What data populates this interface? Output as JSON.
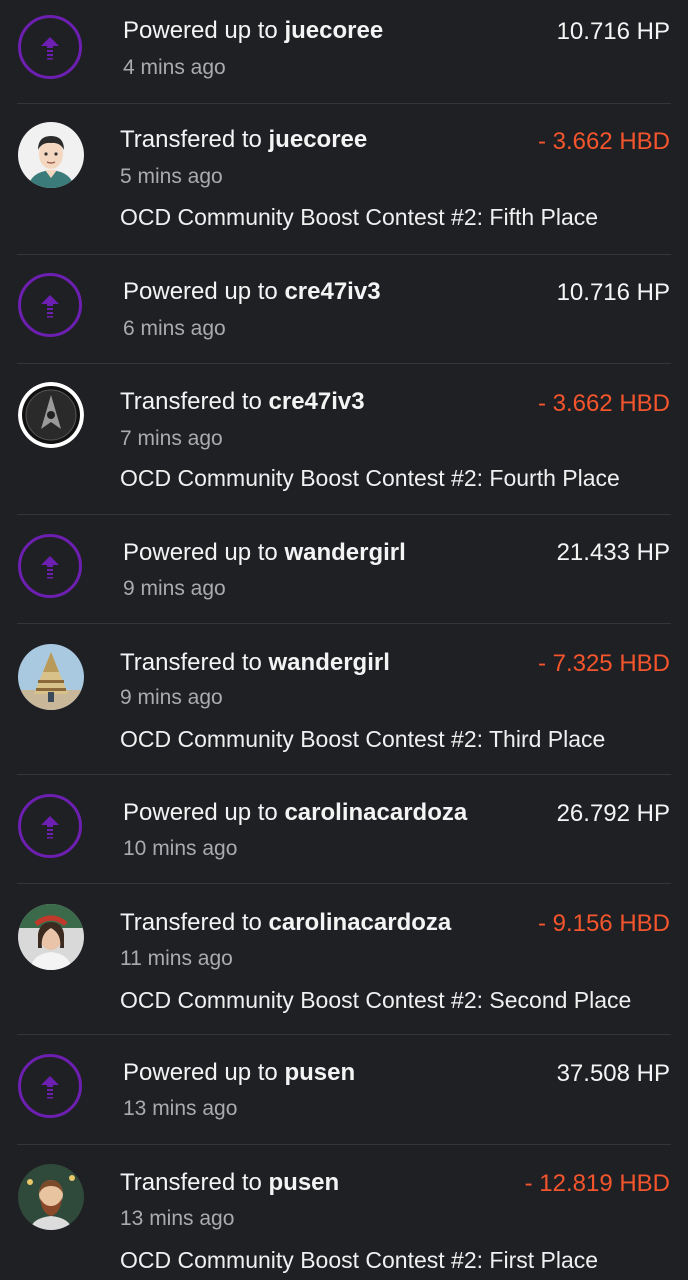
{
  "colors": {
    "background": "#1f2024",
    "accent_purple": "#6c1fb0",
    "negative_amount": "#f4552c"
  },
  "transactions": [
    {
      "type": "power_up",
      "prefix": "Powered up to",
      "user": "juecoree",
      "time": "4 mins ago",
      "amount": "10.716 HP",
      "icon": "power-up-arrow-icon"
    },
    {
      "type": "transfer",
      "prefix": "Transfered to",
      "user": "juecoree",
      "time": "5 mins ago",
      "amount": "- 3.662 HBD",
      "memo": "OCD Community Boost Contest #2: Fifth Place",
      "icon": "avatar-juecoree"
    },
    {
      "type": "power_up",
      "prefix": "Powered up to",
      "user": "cre47iv3",
      "time": "6 mins ago",
      "amount": "10.716 HP",
      "icon": "power-up-arrow-icon"
    },
    {
      "type": "transfer",
      "prefix": "Transfered to",
      "user": "cre47iv3",
      "time": "7 mins ago",
      "amount": "- 3.662 HBD",
      "memo": "OCD Community Boost Contest #2: Fourth Place",
      "icon": "avatar-cre47iv3"
    },
    {
      "type": "power_up",
      "prefix": "Powered up to",
      "user": "wandergirl",
      "time": "9 mins ago",
      "amount": "21.433 HP",
      "icon": "power-up-arrow-icon"
    },
    {
      "type": "transfer",
      "prefix": "Transfered to",
      "user": "wandergirl",
      "time": "9 mins ago",
      "amount": "- 7.325 HBD",
      "memo": "OCD Community Boost Contest #2: Third Place",
      "icon": "avatar-wandergirl"
    },
    {
      "type": "power_up",
      "prefix": "Powered up to",
      "user": "carolinacardoza",
      "time": "10 mins ago",
      "amount": "26.792 HP",
      "icon": "power-up-arrow-icon"
    },
    {
      "type": "transfer",
      "prefix": "Transfered to",
      "user": "carolinacardoza",
      "time": "11 mins ago",
      "amount": "- 9.156 HBD",
      "memo": "OCD Community Boost Contest #2: Second Place",
      "icon": "avatar-carolinacardoza"
    },
    {
      "type": "power_up",
      "prefix": "Powered up to",
      "user": "pusen",
      "time": "13 mins ago",
      "amount": "37.508 HP",
      "icon": "power-up-arrow-icon"
    },
    {
      "type": "transfer",
      "prefix": "Transfered to",
      "user": "pusen",
      "time": "13 mins ago",
      "amount": "- 12.819 HBD",
      "memo": "OCD Community Boost Contest #2: First Place",
      "icon": "avatar-pusen"
    }
  ]
}
